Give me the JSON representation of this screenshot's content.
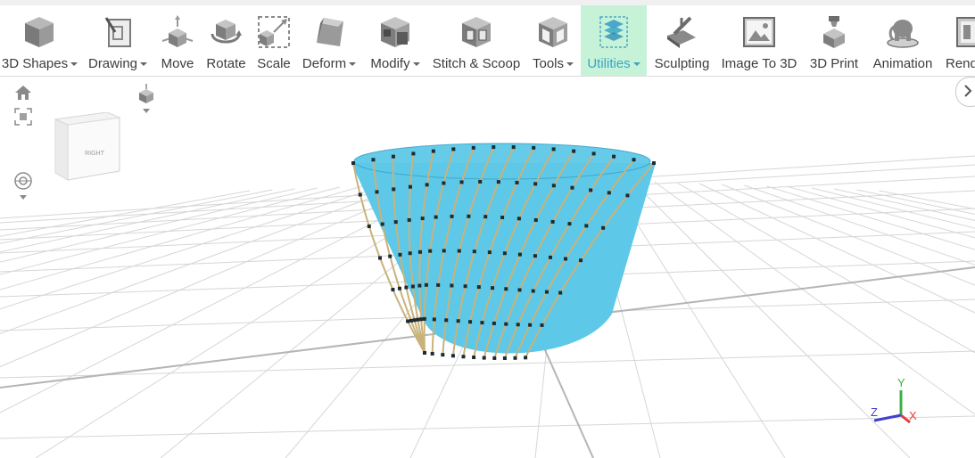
{
  "toolbar": {
    "items": [
      {
        "label": "3D Shapes",
        "icon": "cube-icon",
        "dropdown": true
      },
      {
        "label": "Drawing",
        "icon": "drawing-icon",
        "dropdown": true
      },
      {
        "label": "Move",
        "icon": "move-icon",
        "dropdown": false
      },
      {
        "label": "Rotate",
        "icon": "rotate-icon",
        "dropdown": false
      },
      {
        "label": "Scale",
        "icon": "scale-icon",
        "dropdown": false
      },
      {
        "label": "Deform",
        "icon": "deform-icon",
        "dropdown": true
      },
      {
        "label": "Modify",
        "icon": "modify-icon",
        "dropdown": true
      },
      {
        "label": "Stitch & Scoop",
        "icon": "stitch-scoop-icon",
        "dropdown": false
      },
      {
        "label": "Tools",
        "icon": "tools-icon",
        "dropdown": true
      },
      {
        "label": "Utilities",
        "icon": "utilities-icon",
        "dropdown": true,
        "active": true
      },
      {
        "label": "Sculpting",
        "icon": "sculpting-icon",
        "dropdown": false
      },
      {
        "label": "Image To 3D",
        "icon": "image-to-3d-icon",
        "dropdown": false
      },
      {
        "label": "3D Print",
        "icon": "3d-print-icon",
        "dropdown": false
      },
      {
        "label": "Animation",
        "icon": "animation-icon",
        "dropdown": false
      },
      {
        "label": "Rend",
        "icon": "render-icon",
        "dropdown": false
      }
    ]
  },
  "viewport": {
    "view_cube_face": "RIGHT",
    "axes": {
      "x": "X",
      "y": "Y",
      "z": "Z"
    },
    "model_color": "#5ec8e8",
    "edge_color": "#c9b27a",
    "active_color": "#c6f3d7"
  },
  "nav": {
    "home": "home-icon",
    "fit": "fit-view-icon",
    "perspective": "perspective-cube-icon",
    "orbit": "orbit-icon",
    "expand": "chevron-right-icon"
  }
}
